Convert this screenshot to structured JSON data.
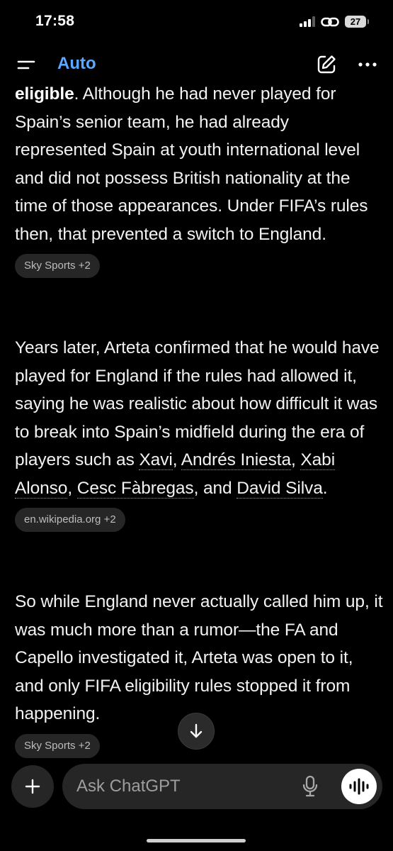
{
  "status_bar": {
    "time": "17:58",
    "battery": "27"
  },
  "header": {
    "model": "Auto"
  },
  "content": {
    "block1": {
      "bold_lead": "eligible",
      "text": ". Although he had never played for Spain’s senior team, he had already represented Spain at youth international level and did not possess British nationality at the time of those appearances. Under FIFA’s rules then, that prevented a switch to England.",
      "source": "Sky Sports +2"
    },
    "block2": {
      "text_before": "Years later, Arteta confirmed that he would have played for England if the rules had allowed it, saying he was realistic about how difficult it was to break into Spain’s midfield during the era of players such as ",
      "entities": [
        "Xavi",
        "Andrés Iniesta",
        "Xabi Alonso",
        "Cesc Fàbregas",
        "David Silva"
      ],
      "sep": ", ",
      "sep_last": ", and ",
      "end": ".",
      "source": "en.wikipedia.org +2"
    },
    "block3": {
      "text": "So while England never actually called him up, it was much more than a rumor—the FA and Capello investigated it, Arteta was open to it, and only FIFA eligibility rules stopped it from happening.",
      "source": "Sky Sports +2"
    }
  },
  "composer": {
    "placeholder": "Ask ChatGPT",
    "value": ""
  },
  "colors": {
    "accent": "#5aa8ff",
    "background": "#000000",
    "chip_background": "#262626"
  },
  "icons": {
    "menu": "menu-icon",
    "compose": "new-chat-icon",
    "more": "more-icon",
    "scroll": "arrow-down-icon",
    "plus": "plus-icon",
    "mic": "microphone-icon",
    "voice": "voice-mode-icon"
  }
}
